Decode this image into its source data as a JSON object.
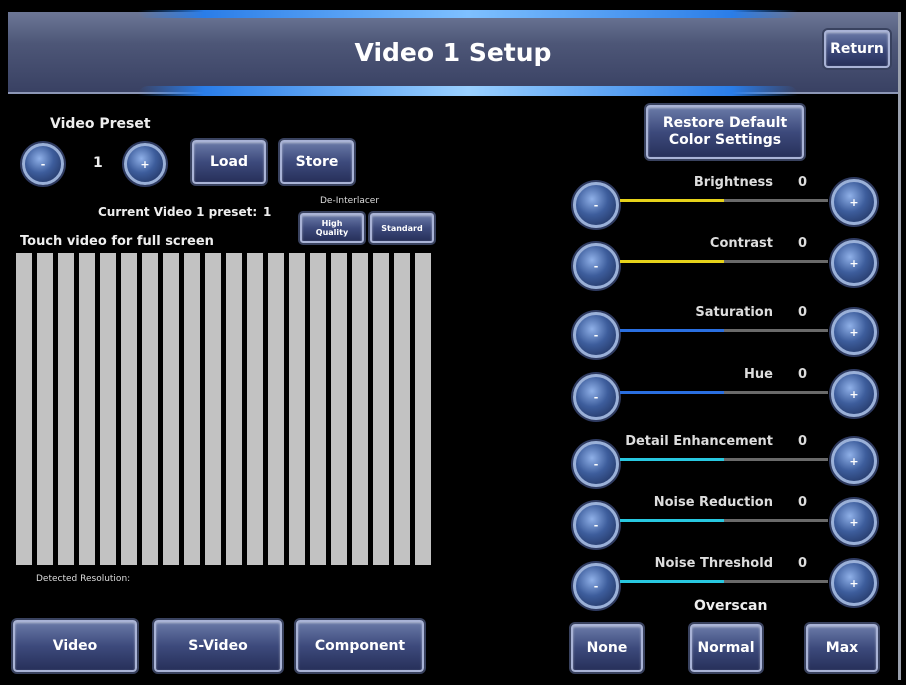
{
  "header": {
    "title": "Video 1 Setup",
    "return_label": "Return"
  },
  "preset": {
    "heading": "Video Preset",
    "value": "1",
    "minus_label": "-",
    "plus_label": "+",
    "load_label": "Load",
    "store_label": "Store",
    "current_label": "Current Video 1 preset:",
    "current_value": "1"
  },
  "deinterlacer": {
    "heading": "De-Interlacer",
    "high_quality_label": "High\nQuality",
    "standard_label": "Standard"
  },
  "video": {
    "touch_label": "Touch video for full screen",
    "detected_resolution_label": "Detected Resolution:"
  },
  "inputs": {
    "video_label": "Video",
    "svideo_label": "S-Video",
    "component_label": "Component"
  },
  "restore": {
    "label": "Restore Default\nColor Settings"
  },
  "controls": [
    {
      "name": "Brightness",
      "value": "0",
      "level": 0.5,
      "color": "#e6d21a"
    },
    {
      "name": "Contrast",
      "value": "0",
      "level": 0.5,
      "color": "#e6d21a"
    },
    {
      "name": "Saturation",
      "value": "0",
      "level": 0.5,
      "color": "#2a6fe0"
    },
    {
      "name": "Hue",
      "value": "0",
      "level": 0.5,
      "color": "#2a6fe0"
    },
    {
      "name": "Detail Enhancement",
      "value": "0",
      "level": 0.5,
      "color": "#28c8e0"
    },
    {
      "name": "Noise Reduction",
      "value": "0",
      "level": 0.5,
      "color": "#28c8e0"
    },
    {
      "name": "Noise Threshold",
      "value": "0",
      "level": 0.5,
      "color": "#28c8e0"
    }
  ],
  "overscan": {
    "heading": "Overscan",
    "none_label": "None",
    "normal_label": "Normal",
    "max_label": "Max"
  }
}
